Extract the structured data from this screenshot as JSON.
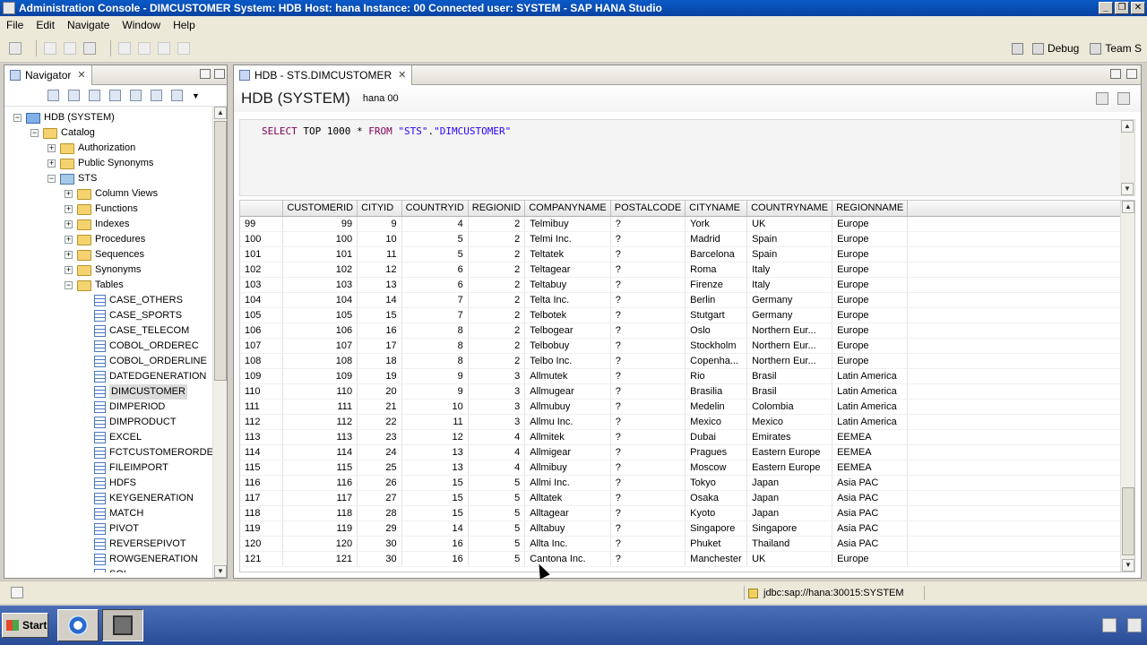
{
  "window": {
    "title": "Administration Console - DIMCUSTOMER System: HDB Host: hana Instance: 00 Connected user: SYSTEM - SAP HANA Studio",
    "controls": [
      "_",
      "❐",
      "✕"
    ]
  },
  "menu": [
    "File",
    "Edit",
    "Navigate",
    "Window",
    "Help"
  ],
  "perspectives": {
    "debug": "Debug",
    "team": "Team S"
  },
  "navigator": {
    "tab_label": "Navigator",
    "tree": [
      {
        "label": "HDB (SYSTEM)",
        "level": 0,
        "icon": "system-icon",
        "toggle": "−"
      },
      {
        "label": "Catalog",
        "level": 1,
        "icon": "folder-icon",
        "toggle": "−"
      },
      {
        "label": "Authorization",
        "level": 2,
        "icon": "folder-icon",
        "toggle": "+"
      },
      {
        "label": "Public Synonyms",
        "level": 2,
        "icon": "folder-icon",
        "toggle": "+"
      },
      {
        "label": "STS",
        "level": 2,
        "icon": "schema-icon",
        "toggle": "−"
      },
      {
        "label": "Column Views",
        "level": 3,
        "icon": "folder-icon",
        "toggle": "+"
      },
      {
        "label": "Functions",
        "level": 3,
        "icon": "folder-icon",
        "toggle": "+"
      },
      {
        "label": "Indexes",
        "level": 3,
        "icon": "folder-icon",
        "toggle": "+"
      },
      {
        "label": "Procedures",
        "level": 3,
        "icon": "folder-icon",
        "toggle": "+"
      },
      {
        "label": "Sequences",
        "level": 3,
        "icon": "folder-icon",
        "toggle": "+"
      },
      {
        "label": "Synonyms",
        "level": 3,
        "icon": "folder-icon",
        "toggle": "+"
      },
      {
        "label": "Tables",
        "level": 3,
        "icon": "folder-icon",
        "toggle": "−"
      },
      {
        "label": "CASE_OTHERS",
        "level": 4,
        "icon": "table-icon"
      },
      {
        "label": "CASE_SPORTS",
        "level": 4,
        "icon": "table-icon"
      },
      {
        "label": "CASE_TELECOM",
        "level": 4,
        "icon": "table-icon"
      },
      {
        "label": "COBOL_ORDEREC",
        "level": 4,
        "icon": "table-icon"
      },
      {
        "label": "COBOL_ORDERLINE",
        "level": 4,
        "icon": "table-icon"
      },
      {
        "label": "DATEDGENERATION",
        "level": 4,
        "icon": "table-icon"
      },
      {
        "label": "DIMCUSTOMER",
        "level": 4,
        "icon": "table-icon",
        "selected": true
      },
      {
        "label": "DIMPERIOD",
        "level": 4,
        "icon": "table-icon"
      },
      {
        "label": "DIMPRODUCT",
        "level": 4,
        "icon": "table-icon"
      },
      {
        "label": "EXCEL",
        "level": 4,
        "icon": "table-icon"
      },
      {
        "label": "FCTCUSTOMERORDER",
        "level": 4,
        "icon": "table-icon"
      },
      {
        "label": "FILEIMPORT",
        "level": 4,
        "icon": "table-icon"
      },
      {
        "label": "HDFS",
        "level": 4,
        "icon": "table-icon"
      },
      {
        "label": "KEYGENERATION",
        "level": 4,
        "icon": "table-icon"
      },
      {
        "label": "MATCH",
        "level": 4,
        "icon": "table-icon"
      },
      {
        "label": "PIVOT",
        "level": 4,
        "icon": "table-icon"
      },
      {
        "label": "REVERSEPIVOT",
        "level": 4,
        "icon": "table-icon"
      },
      {
        "label": "ROWGENERATION",
        "level": 4,
        "icon": "table-icon"
      },
      {
        "label": "SQL",
        "level": 4,
        "icon": "table-icon"
      }
    ]
  },
  "editor": {
    "tab_label": "HDB - STS.DIMCUSTOMER",
    "title": "HDB (SYSTEM)",
    "instance": "hana 00",
    "sql": {
      "kw1": "SELECT",
      "mid1": " TOP 1000 * ",
      "kw2": "FROM",
      "sp": " ",
      "schema": "\"STS\"",
      "dot": ".",
      "table": "\"DIMCUSTOMER\""
    },
    "result": {
      "columns": [
        "",
        "CUSTOMERID",
        "CITYID",
        "COUNTRYID",
        "REGIONID",
        "COMPANYNAME",
        "POSTALCODE",
        "CITYNAME",
        "COUNTRYNAME",
        "REGIONNAME"
      ],
      "rows": [
        [
          "99",
          "99",
          "9",
          "4",
          "2",
          "Telmibuy",
          "?",
          "York",
          "UK",
          "Europe"
        ],
        [
          "100",
          "100",
          "10",
          "5",
          "2",
          "Telmi Inc.",
          "?",
          "Madrid",
          "Spain",
          "Europe"
        ],
        [
          "101",
          "101",
          "11",
          "5",
          "2",
          "Teltatek",
          "?",
          "Barcelona",
          "Spain",
          "Europe"
        ],
        [
          "102",
          "102",
          "12",
          "6",
          "2",
          "Teltagear",
          "?",
          "Roma",
          "Italy",
          "Europe"
        ],
        [
          "103",
          "103",
          "13",
          "6",
          "2",
          "Teltabuy",
          "?",
          "Firenze",
          "Italy",
          "Europe"
        ],
        [
          "104",
          "104",
          "14",
          "7",
          "2",
          "Telta Inc.",
          "?",
          "Berlin",
          "Germany",
          "Europe"
        ],
        [
          "105",
          "105",
          "15",
          "7",
          "2",
          "Telbotek",
          "?",
          "Stutgart",
          "Germany",
          "Europe"
        ],
        [
          "106",
          "106",
          "16",
          "8",
          "2",
          "Telbogear",
          "?",
          "Oslo",
          "Northern Eur...",
          "Europe"
        ],
        [
          "107",
          "107",
          "17",
          "8",
          "2",
          "Telbobuy",
          "?",
          "Stockholm",
          "Northern Eur...",
          "Europe"
        ],
        [
          "108",
          "108",
          "18",
          "8",
          "2",
          "Telbo Inc.",
          "?",
          "Copenha...",
          "Northern Eur...",
          "Europe"
        ],
        [
          "109",
          "109",
          "19",
          "9",
          "3",
          "Allmutek",
          "?",
          "Rio",
          "Brasil",
          "Latin America"
        ],
        [
          "110",
          "110",
          "20",
          "9",
          "3",
          "Allmugear",
          "?",
          "Brasilia",
          "Brasil",
          "Latin America"
        ],
        [
          "111",
          "111",
          "21",
          "10",
          "3",
          "Allmubuy",
          "?",
          "Medelin",
          "Colombia",
          "Latin America"
        ],
        [
          "112",
          "112",
          "22",
          "11",
          "3",
          "Allmu Inc.",
          "?",
          "Mexico",
          "Mexico",
          "Latin America"
        ],
        [
          "113",
          "113",
          "23",
          "12",
          "4",
          "Allmitek",
          "?",
          "Dubai",
          "Emirates",
          "EEMEA"
        ],
        [
          "114",
          "114",
          "24",
          "13",
          "4",
          "Allmigear",
          "?",
          "Pragues",
          "Eastern Europe",
          "EEMEA"
        ],
        [
          "115",
          "115",
          "25",
          "13",
          "4",
          "Allmibuy",
          "?",
          "Moscow",
          "Eastern Europe",
          "EEMEA"
        ],
        [
          "116",
          "116",
          "26",
          "15",
          "5",
          "Allmi Inc.",
          "?",
          "Tokyo",
          "Japan",
          "Asia PAC"
        ],
        [
          "117",
          "117",
          "27",
          "15",
          "5",
          "Alltatek",
          "?",
          "Osaka",
          "Japan",
          "Asia PAC"
        ],
        [
          "118",
          "118",
          "28",
          "15",
          "5",
          "Alltagear",
          "?",
          "Kyoto",
          "Japan",
          "Asia PAC"
        ],
        [
          "119",
          "119",
          "29",
          "14",
          "5",
          "Alltabuy",
          "?",
          "Singapore",
          "Singapore",
          "Asia PAC"
        ],
        [
          "120",
          "120",
          "30",
          "16",
          "5",
          "Allta Inc.",
          "?",
          "Phuket",
          "Thailand",
          "Asia PAC"
        ],
        [
          "121",
          "121",
          "30",
          "16",
          "5",
          "Cantona Inc.",
          "?",
          "Manchester",
          "UK",
          "Europe"
        ]
      ]
    }
  },
  "status": {
    "connection": "jdbc:sap://hana:30015:SYSTEM"
  },
  "taskbar": {
    "start_label": "Start"
  }
}
